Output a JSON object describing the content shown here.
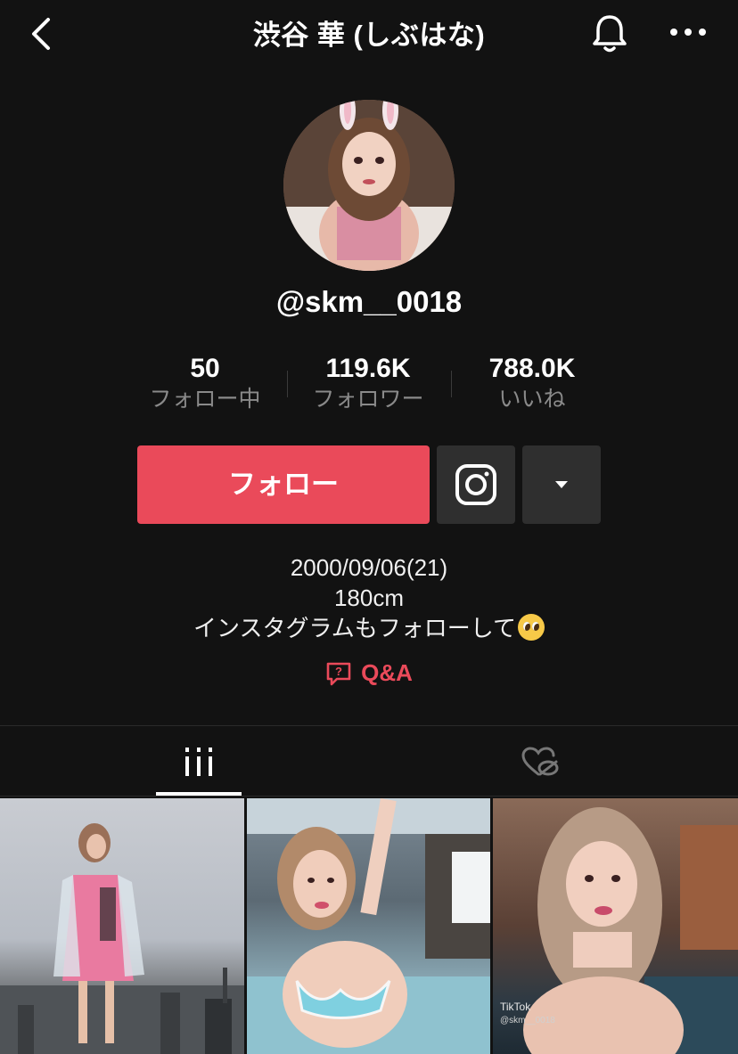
{
  "header": {
    "title": "渋谷 華 (しぶはな)"
  },
  "profile": {
    "handle": "@skm__0018"
  },
  "stats": [
    {
      "value": "50",
      "label": "フォロー中"
    },
    {
      "value": "119.6K",
      "label": "フォロワー"
    },
    {
      "value": "788.0K",
      "label": "いいね"
    }
  ],
  "actions": {
    "follow_label": "フォロー"
  },
  "bio": {
    "line1": "2000/09/06(21)",
    "line2": "180cm",
    "line3": "インスタグラムもフォローして"
  },
  "qa": {
    "label": "Q&A"
  },
  "thumbnails": {
    "watermark_brand": "TikTok",
    "watermark_handle": "@skm__0018"
  },
  "colors": {
    "background": "#121212",
    "accent": "#ea4a5a",
    "secondary_button": "#2f2f2f",
    "muted_text": "#8a8a8a"
  },
  "icons": {
    "back": "chevron-left-icon",
    "bell": "bell-icon",
    "more": "more-horizontal-icon",
    "instagram": "instagram-icon",
    "dropdown": "caret-down-icon",
    "qa": "question-bubble-icon",
    "videos_tab": "grid-bars-icon",
    "liked_tab": "heart-hidden-icon"
  }
}
